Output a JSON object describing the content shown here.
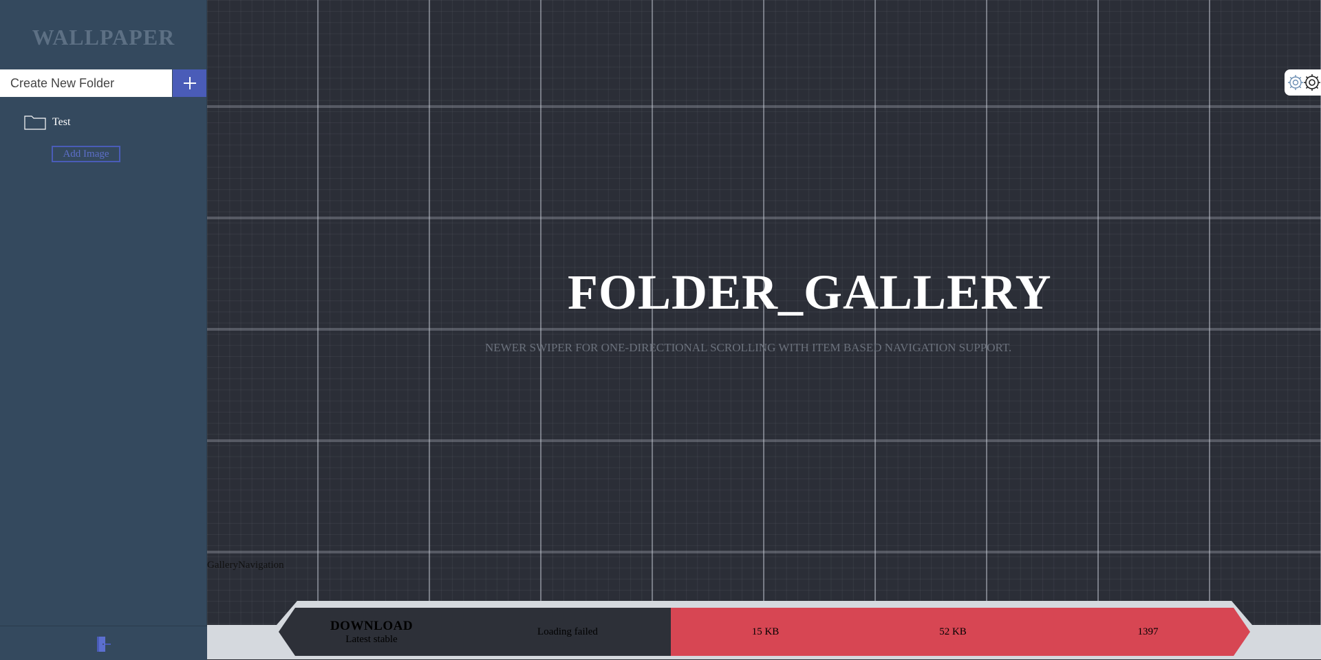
{
  "sidebar": {
    "brand": "WALLPAPER",
    "new_folder_placeholder": "Create New Folder",
    "folders": [
      {
        "name": "Test",
        "add_image_label": "Add Image"
      }
    ]
  },
  "main": {
    "title": "FOLDER_GALLERY",
    "subtitle": "NEWER SWIPER FOR ONE-DIRECTIONAL SCROLLING WITH ITEM BASED NAVIGATION SUPPORT.",
    "gallery_nav_label": "GalleryNavigation"
  },
  "download_bar": {
    "title": "DOWNLOAD",
    "subtitle": "Latest stable",
    "status": "Loading failed",
    "size_min": "15 KB",
    "size_full": "52 KB",
    "count": "1397"
  },
  "colors": {
    "sidebar_bg": "#34495e",
    "accent": "#4a5cb8",
    "grid_bg": "#2b2e37",
    "danger": "#d74653"
  },
  "icons": {
    "add_folder": "plus-icon",
    "folder": "folder-icon",
    "logout": "logout-icon",
    "settings": "gear-icon"
  }
}
